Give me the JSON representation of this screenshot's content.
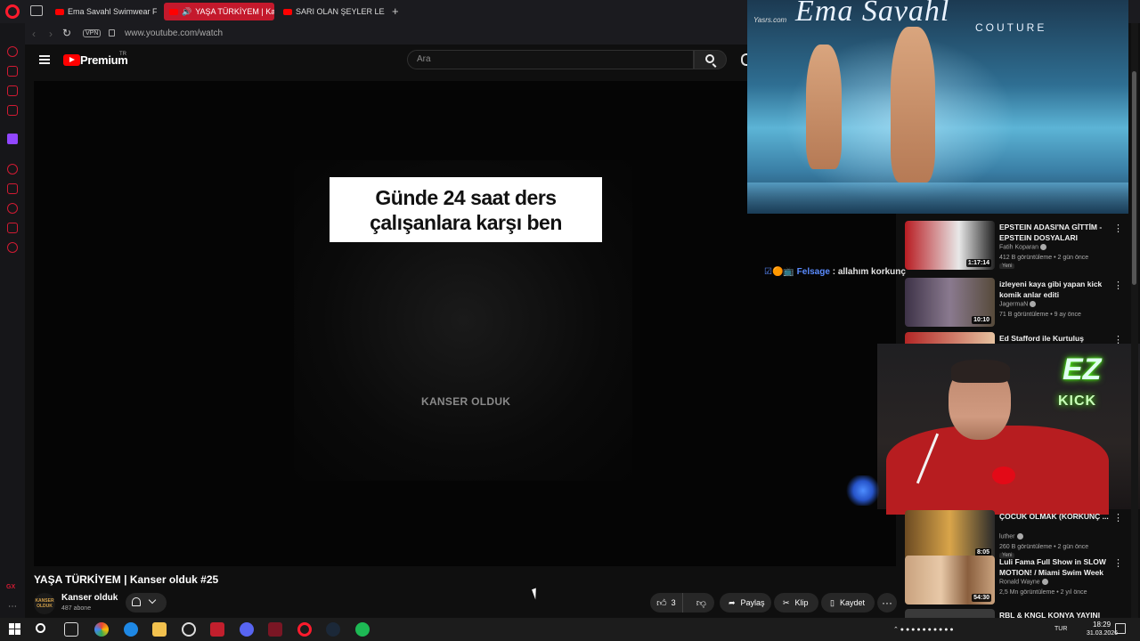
{
  "browser": {
    "tabs": [
      {
        "label": "Ema Savahl Swimwear Fas",
        "active": false
      },
      {
        "label": "YAŞA TÜRKİYEM | Kan",
        "active": true
      },
      {
        "label": "SARI OLAN ŞEYLER LEZZE",
        "active": false
      }
    ],
    "new_tab": "+",
    "vpn_label": "VPN",
    "url": "www.youtube.com/watch",
    "accent": "#ff1b2d"
  },
  "youtube": {
    "brand": "Premium",
    "region": "TR",
    "search_placeholder": "Ara"
  },
  "player": {
    "caption_line1": "Günde 24 saat ders",
    "caption_line2": "çalışanlara karşı ben",
    "watermark": "KANSER OLDUK"
  },
  "video": {
    "title": "YAŞA TÜRKİYEM | Kanser olduk #25",
    "channel_avatar_text": "KANSER OLDUK",
    "channel": "Kanser olduk",
    "subscribers": "487 abone",
    "likes": "3",
    "share": "Paylaş",
    "clip": "Klip",
    "save": "Kaydet",
    "more": "···"
  },
  "overlay": {
    "brand_title": "Ema Savahl",
    "brand_sub": "COUTURE",
    "site_watermark": "Yasrs.com"
  },
  "chat": {
    "badges": "☑🟠📺",
    "user": "Felsage",
    "separator": ":",
    "message": "allahım korkunç"
  },
  "recommendations": [
    {
      "title": "EPSTEIN ADASI'NA GİTTİM - EPSTEIN DOSYALARI",
      "channel": "Fatih Koparan",
      "meta": "412 B görüntüleme • 2 gün önce",
      "badge": "Yeni",
      "duration": "1:17:14",
      "thumb_color": "#b81c22"
    },
    {
      "title": "izleyeni kaya gibi yapan kick komik anlar editi",
      "channel": "JagermaN",
      "meta": "71 B görüntüleme • 9 ay önce",
      "badge": "",
      "duration": "10:10",
      "thumb_color": "#3d3247"
    },
    {
      "title": "Ed Stafford ile Kurtuluş Öyküleri",
      "channel": "",
      "meta": "",
      "badge": "",
      "duration": "",
      "thumb_color": "#b32626"
    },
    {
      "title": "ÇOCUK OLMAK (KORKUNÇ ...",
      "channel": "luther",
      "meta": "260 B görüntüleme • 2 gün önce",
      "badge": "Yeni",
      "duration": "8:05",
      "thumb_color": "#6b4a22"
    },
    {
      "title": "Luli Fama Full Show in SLOW MOTION! / Miami Swim Week ...",
      "channel": "Ronald Wayne",
      "meta": "2,5 Mn görüntüleme • 2 yıl önce",
      "badge": "",
      "duration": "54:30",
      "thumb_color": "#c9a27e"
    },
    {
      "title": "RBL & KNGL KONYA YAYINI",
      "channel": "",
      "meta": "",
      "badge": "",
      "duration": "",
      "thumb_color": "#3a3a3a"
    }
  ],
  "webcam": {
    "overlay_top": "EZ",
    "overlay_bottom": "KICK"
  },
  "taskbar": {
    "lang": "TUR",
    "time": "18:29",
    "date": "31.03.2026"
  }
}
